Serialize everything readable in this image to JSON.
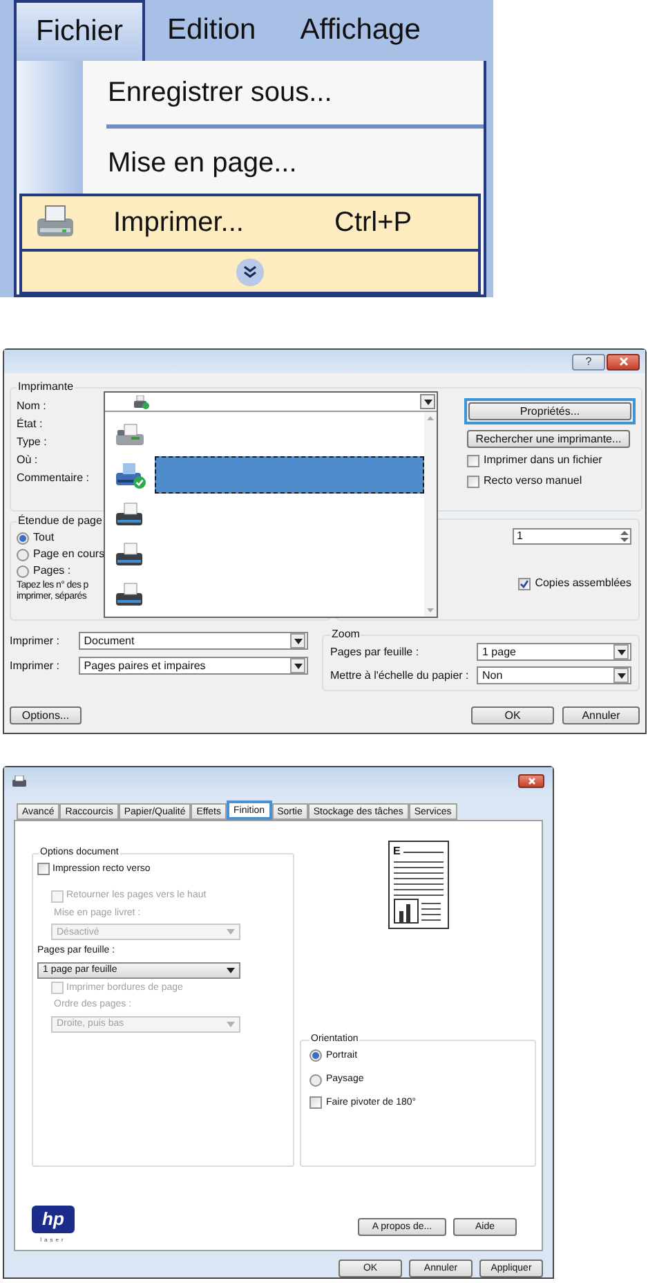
{
  "menu": {
    "menubar": [
      {
        "label": "Fichier",
        "selected": true
      },
      {
        "label": "Edition",
        "selected": false
      },
      {
        "label": "Affichage",
        "selected": false
      }
    ],
    "entries": [
      {
        "label": "Enregistrer sous...",
        "highlighted": false,
        "separator_after": true
      },
      {
        "label": "Mise en page...",
        "highlighted": false,
        "separator_after": false
      },
      {
        "label": "Imprimer...",
        "shortcut": "Ctrl+P",
        "kind": "printer",
        "highlighted": true,
        "separator_after": false
      }
    ]
  },
  "print_dialog": {
    "help_button": "?",
    "printer_group": {
      "title": "Imprimante",
      "labels": [
        "Nom :",
        "État :",
        "Type :",
        "Où :",
        "Commentaire :"
      ]
    },
    "properties_button": "Propriétés...",
    "find_button": "Rechercher une imprimante...",
    "checkboxes": [
      {
        "label": "Imprimer dans un fichier",
        "checked": false
      },
      {
        "label": "Recto verso manuel",
        "checked": false
      }
    ],
    "printer_list": [
      {
        "kind": "fax",
        "selected": false
      },
      {
        "kind": "default",
        "selected": true
      },
      {
        "kind": "printer",
        "selected": false
      },
      {
        "kind": "printer",
        "selected": false
      },
      {
        "kind": "printer",
        "selected": false
      }
    ],
    "page_range": {
      "title": "Étendue de page",
      "options": [
        {
          "label": "Tout",
          "selected": true
        },
        {
          "label": "Page en cours",
          "selected": false
        },
        {
          "label": "Pages :",
          "selected": false
        }
      ],
      "hint": [
        "Tapez les n° des p",
        "imprimer, séparés"
      ]
    },
    "copies_value": "1",
    "collate": {
      "label": "Copies assemblées",
      "checked": true
    },
    "print_rows": [
      {
        "label": "Imprimer :",
        "value": "Document"
      },
      {
        "label": "Imprimer :",
        "value": "Pages paires et impaires"
      }
    ],
    "zoom": {
      "title": "Zoom",
      "rows": [
        {
          "label": "Pages par feuille :",
          "value": "1 page"
        },
        {
          "label": "Mettre à l'échelle du papier :",
          "value": "Non"
        }
      ]
    },
    "options_button": "Options...",
    "ok_button": "OK",
    "cancel_button": "Annuler"
  },
  "properties_dialog": {
    "tabs": [
      {
        "label": "Avancé",
        "selected": false
      },
      {
        "label": "Raccourcis",
        "selected": false
      },
      {
        "label": "Papier/Qualité",
        "selected": false
      },
      {
        "label": "Effets",
        "selected": false
      },
      {
        "label": "Finition",
        "selected": true
      },
      {
        "label": "Sortie",
        "selected": false
      },
      {
        "label": "Stockage des tâches",
        "selected": false
      },
      {
        "label": "Services",
        "selected": false
      }
    ],
    "document_options": {
      "title": "Options document",
      "duplex": {
        "label": "Impression recto verso",
        "checked": false,
        "disabled": false
      },
      "flip": {
        "label": "Retourner les pages vers le haut",
        "checked": false,
        "disabled": true
      },
      "booklet": {
        "label": "Mise en page livret :",
        "value": "Désactivé",
        "disabled": true
      },
      "pages_per_sheet": {
        "label": "Pages par feuille :",
        "value": "1 page par feuille",
        "disabled": false
      },
      "borders": {
        "label": "Imprimer bordures de page",
        "checked": false,
        "disabled": true
      },
      "page_order": {
        "label": "Ordre des pages :",
        "value": "Droite, puis bas",
        "disabled": true
      }
    },
    "preview_letter": "E",
    "orientation": {
      "title": "Orientation",
      "options": [
        {
          "label": "Portrait",
          "selected": true
        },
        {
          "label": "Paysage",
          "selected": false
        }
      ],
      "rotate": {
        "label": "Faire pivoter de 180°",
        "checked": false
      }
    },
    "logo": {
      "text": "hp",
      "caption": "laser"
    },
    "about_button": "A propos de...",
    "help_button": "Aide",
    "ok_button": "OK",
    "cancel_button": "Annuler",
    "apply_button": "Appliquer"
  }
}
